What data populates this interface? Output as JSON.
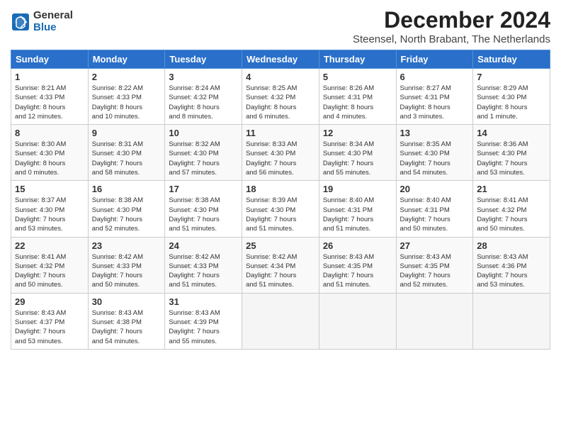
{
  "logo": {
    "general": "General",
    "blue": "Blue"
  },
  "title": "December 2024",
  "subtitle": "Steensel, North Brabant, The Netherlands",
  "weekdays": [
    "Sunday",
    "Monday",
    "Tuesday",
    "Wednesday",
    "Thursday",
    "Friday",
    "Saturday"
  ],
  "weeks": [
    [
      {
        "day": 1,
        "detail": "Sunrise: 8:21 AM\nSunset: 4:33 PM\nDaylight: 8 hours\nand 12 minutes."
      },
      {
        "day": 2,
        "detail": "Sunrise: 8:22 AM\nSunset: 4:33 PM\nDaylight: 8 hours\nand 10 minutes."
      },
      {
        "day": 3,
        "detail": "Sunrise: 8:24 AM\nSunset: 4:32 PM\nDaylight: 8 hours\nand 8 minutes."
      },
      {
        "day": 4,
        "detail": "Sunrise: 8:25 AM\nSunset: 4:32 PM\nDaylight: 8 hours\nand 6 minutes."
      },
      {
        "day": 5,
        "detail": "Sunrise: 8:26 AM\nSunset: 4:31 PM\nDaylight: 8 hours\nand 4 minutes."
      },
      {
        "day": 6,
        "detail": "Sunrise: 8:27 AM\nSunset: 4:31 PM\nDaylight: 8 hours\nand 3 minutes."
      },
      {
        "day": 7,
        "detail": "Sunrise: 8:29 AM\nSunset: 4:30 PM\nDaylight: 8 hours\nand 1 minute."
      }
    ],
    [
      {
        "day": 8,
        "detail": "Sunrise: 8:30 AM\nSunset: 4:30 PM\nDaylight: 8 hours\nand 0 minutes."
      },
      {
        "day": 9,
        "detail": "Sunrise: 8:31 AM\nSunset: 4:30 PM\nDaylight: 7 hours\nand 58 minutes."
      },
      {
        "day": 10,
        "detail": "Sunrise: 8:32 AM\nSunset: 4:30 PM\nDaylight: 7 hours\nand 57 minutes."
      },
      {
        "day": 11,
        "detail": "Sunrise: 8:33 AM\nSunset: 4:30 PM\nDaylight: 7 hours\nand 56 minutes."
      },
      {
        "day": 12,
        "detail": "Sunrise: 8:34 AM\nSunset: 4:30 PM\nDaylight: 7 hours\nand 55 minutes."
      },
      {
        "day": 13,
        "detail": "Sunrise: 8:35 AM\nSunset: 4:30 PM\nDaylight: 7 hours\nand 54 minutes."
      },
      {
        "day": 14,
        "detail": "Sunrise: 8:36 AM\nSunset: 4:30 PM\nDaylight: 7 hours\nand 53 minutes."
      }
    ],
    [
      {
        "day": 15,
        "detail": "Sunrise: 8:37 AM\nSunset: 4:30 PM\nDaylight: 7 hours\nand 53 minutes."
      },
      {
        "day": 16,
        "detail": "Sunrise: 8:38 AM\nSunset: 4:30 PM\nDaylight: 7 hours\nand 52 minutes."
      },
      {
        "day": 17,
        "detail": "Sunrise: 8:38 AM\nSunset: 4:30 PM\nDaylight: 7 hours\nand 51 minutes."
      },
      {
        "day": 18,
        "detail": "Sunrise: 8:39 AM\nSunset: 4:30 PM\nDaylight: 7 hours\nand 51 minutes."
      },
      {
        "day": 19,
        "detail": "Sunrise: 8:40 AM\nSunset: 4:31 PM\nDaylight: 7 hours\nand 51 minutes."
      },
      {
        "day": 20,
        "detail": "Sunrise: 8:40 AM\nSunset: 4:31 PM\nDaylight: 7 hours\nand 50 minutes."
      },
      {
        "day": 21,
        "detail": "Sunrise: 8:41 AM\nSunset: 4:32 PM\nDaylight: 7 hours\nand 50 minutes."
      }
    ],
    [
      {
        "day": 22,
        "detail": "Sunrise: 8:41 AM\nSunset: 4:32 PM\nDaylight: 7 hours\nand 50 minutes."
      },
      {
        "day": 23,
        "detail": "Sunrise: 8:42 AM\nSunset: 4:33 PM\nDaylight: 7 hours\nand 50 minutes."
      },
      {
        "day": 24,
        "detail": "Sunrise: 8:42 AM\nSunset: 4:33 PM\nDaylight: 7 hours\nand 51 minutes."
      },
      {
        "day": 25,
        "detail": "Sunrise: 8:42 AM\nSunset: 4:34 PM\nDaylight: 7 hours\nand 51 minutes."
      },
      {
        "day": 26,
        "detail": "Sunrise: 8:43 AM\nSunset: 4:35 PM\nDaylight: 7 hours\nand 51 minutes."
      },
      {
        "day": 27,
        "detail": "Sunrise: 8:43 AM\nSunset: 4:35 PM\nDaylight: 7 hours\nand 52 minutes."
      },
      {
        "day": 28,
        "detail": "Sunrise: 8:43 AM\nSunset: 4:36 PM\nDaylight: 7 hours\nand 53 minutes."
      }
    ],
    [
      {
        "day": 29,
        "detail": "Sunrise: 8:43 AM\nSunset: 4:37 PM\nDaylight: 7 hours\nand 53 minutes."
      },
      {
        "day": 30,
        "detail": "Sunrise: 8:43 AM\nSunset: 4:38 PM\nDaylight: 7 hours\nand 54 minutes."
      },
      {
        "day": 31,
        "detail": "Sunrise: 8:43 AM\nSunset: 4:39 PM\nDaylight: 7 hours\nand 55 minutes."
      },
      null,
      null,
      null,
      null
    ]
  ]
}
